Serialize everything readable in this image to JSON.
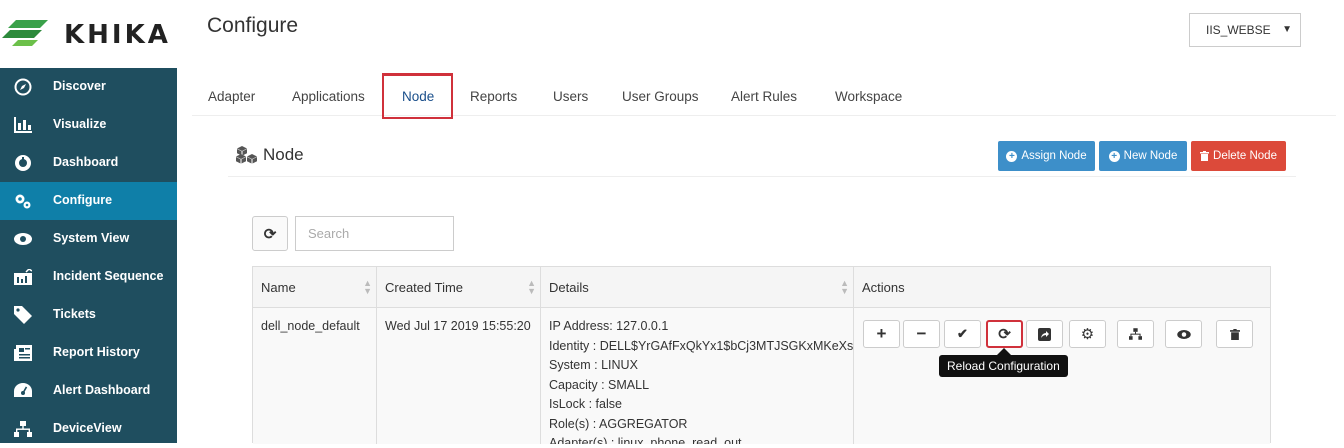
{
  "app": {
    "logo_text": "KHIKA",
    "page_title": "Configure",
    "workspace_select": "IIS_WEBSE"
  },
  "sidebar": {
    "items": [
      {
        "label": "Discover",
        "icon": "compass-icon"
      },
      {
        "label": "Visualize",
        "icon": "bar-chart-icon"
      },
      {
        "label": "Dashboard",
        "icon": "dashboard-icon"
      },
      {
        "label": "Configure",
        "icon": "gears-icon",
        "active": true
      },
      {
        "label": "System View",
        "icon": "eye-icon"
      },
      {
        "label": "Incident Sequence",
        "icon": "incident-chart-icon"
      },
      {
        "label": "Tickets",
        "icon": "tag-icon"
      },
      {
        "label": "Report History",
        "icon": "newspaper-icon"
      },
      {
        "label": "Alert Dashboard",
        "icon": "palette-icon"
      },
      {
        "label": "DeviceView",
        "icon": "sitemap-icon"
      }
    ]
  },
  "tabs": [
    {
      "label": "Adapter"
    },
    {
      "label": "Applications"
    },
    {
      "label": "Node",
      "active": true
    },
    {
      "label": "Reports"
    },
    {
      "label": "Users"
    },
    {
      "label": "User Groups"
    },
    {
      "label": "Alert Rules"
    },
    {
      "label": "Workspace"
    }
  ],
  "section": {
    "title": "Node",
    "assign_node_label": "Assign Node",
    "new_node_label": "New Node",
    "delete_node_label": "Delete Node"
  },
  "search": {
    "placeholder": "Search"
  },
  "table": {
    "headers": [
      "Name",
      "Created Time",
      "Details",
      "Actions"
    ],
    "rows": [
      {
        "name": "dell_node_default",
        "created_time": "Wed Jul 17 2019 15:55:20",
        "details": [
          "IP Address: 127.0.0.1",
          "Identity : DELL$YrGAfFxQkYx1$bCj3MTJSGKxMKeXs",
          "System : LINUX",
          "Capacity : SMALL",
          "IsLock : false",
          "Role(s) : AGGREGATOR",
          "Adapter(s) : linux_phone_read_out"
        ]
      }
    ]
  },
  "tooltip": "Reload Configuration",
  "colors": {
    "sidebar_bg": "#1f4e5f",
    "sidebar_active": "#0f7fa8",
    "button_blue": "#3d8fc9",
    "button_red": "#dc4a3a",
    "highlight_red": "#d0313b",
    "logo_green": "#3aa14a"
  }
}
